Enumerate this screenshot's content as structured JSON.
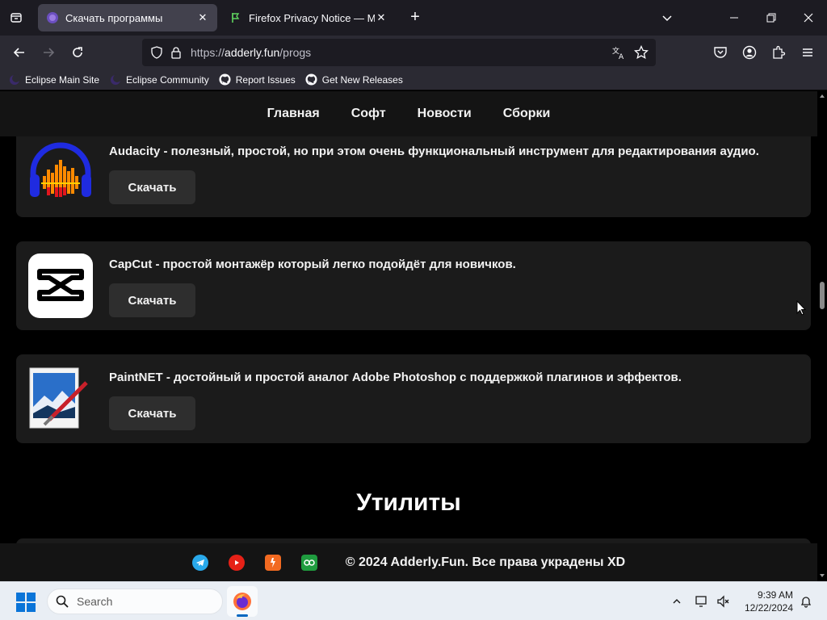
{
  "browser": {
    "tabs": [
      {
        "title": "Скачать программы",
        "active": true
      },
      {
        "title": "Firefox Privacy Notice — Mozill",
        "active": false
      }
    ],
    "url": {
      "scheme": "https://",
      "host": "adderly.fun",
      "path": "/progs"
    },
    "bookmarks": [
      {
        "label": "Eclipse Main Site",
        "icon": "eclipse-icon"
      },
      {
        "label": "Eclipse Community",
        "icon": "eclipse-icon"
      },
      {
        "label": "Report Issues",
        "icon": "github-icon"
      },
      {
        "label": "Get New Releases",
        "icon": "github-icon"
      }
    ]
  },
  "site": {
    "nav": [
      "Главная",
      "Софт",
      "Новости",
      "Сборки"
    ],
    "cards": [
      {
        "name": "Audacity",
        "description": "Audacity - полезный, простой, но при этом очень функциональный инструмент для редактирования аудио.",
        "button": "Скачать"
      },
      {
        "name": "CapCut",
        "description": "CapCut - простой монтажёр который легко подойдёт для новичков.",
        "button": "Скачать"
      },
      {
        "name": "PaintNET",
        "description": "PaintNET - достойный и простой аналог Adobe Photoshop с поддержкой плагинов и эффектов.",
        "button": "Скачать"
      }
    ],
    "section_title": "Утилиты",
    "footer": {
      "social": [
        "telegram-icon",
        "youtube-icon",
        "boosty-icon",
        "donationalerts-icon"
      ],
      "copyright": "© 2024 Adderly.Fun. Все права украдены XD"
    }
  },
  "taskbar": {
    "search_label": "Search",
    "time": "9:39 AM",
    "date": "12/22/2024"
  },
  "colors": {
    "page_bg": "#000000",
    "card_bg": "#1b1b1b",
    "button_bg": "#2e2e2e",
    "browser_chrome": "#2b2a33",
    "tabstrip": "#1c1b22"
  }
}
